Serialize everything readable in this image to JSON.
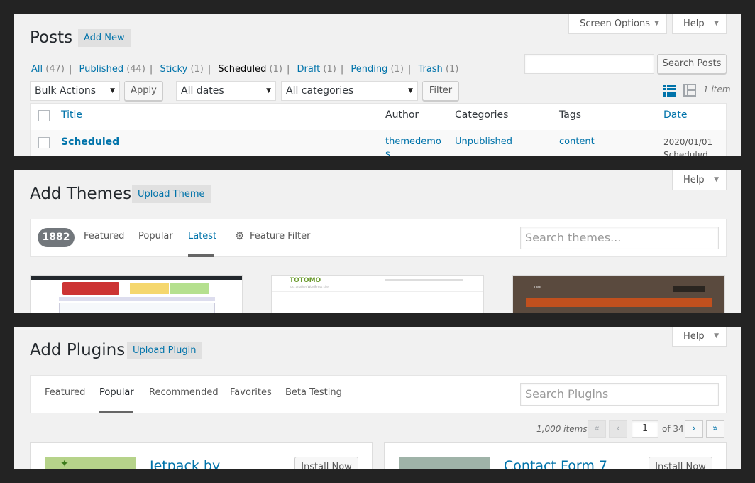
{
  "posts": {
    "title": "Posts",
    "add_new": "Add New",
    "screen_options": "Screen Options",
    "help": "Help",
    "views": [
      {
        "label": "All",
        "count": "(47)"
      },
      {
        "label": "Published",
        "count": "(44)"
      },
      {
        "label": "Sticky",
        "count": "(1)"
      },
      {
        "label": "Scheduled",
        "count": "(1)"
      },
      {
        "label": "Draft",
        "count": "(1)"
      },
      {
        "label": "Pending",
        "count": "(1)"
      },
      {
        "label": "Trash",
        "count": "(1)"
      }
    ],
    "search_button": "Search Posts",
    "search_value": "",
    "bulk_actions": "Bulk Actions",
    "apply": "Apply",
    "all_dates": "All dates",
    "all_categories": "All categories",
    "filter": "Filter",
    "item_count": "1 item",
    "columns": {
      "title": "Title",
      "author": "Author",
      "categories": "Categories",
      "tags": "Tags",
      "date": "Date"
    },
    "row": {
      "title": "Scheduled",
      "author_line1": "themedemo",
      "author_line2": "s",
      "category": "Unpublished",
      "tag": "content",
      "date": "2020/01/01",
      "status": "Scheduled"
    }
  },
  "themes": {
    "title": "Add Themes",
    "upload": "Upload Theme",
    "help": "Help",
    "count": "1882",
    "tabs": [
      "Featured",
      "Popular",
      "Latest"
    ],
    "feature_filter": "Feature Filter",
    "search_placeholder": "Search themes...",
    "thumb_totomo_name": "TOTOMO",
    "thumb_totomo_tagline": "just another WordPress site",
    "thumb_dark_name": "Dali"
  },
  "plugins": {
    "title": "Add Plugins",
    "upload": "Upload Plugin",
    "help": "Help",
    "tabs": [
      "Featured",
      "Popular",
      "Recommended",
      "Favorites",
      "Beta Testing"
    ],
    "search_placeholder": "Search Plugins",
    "items": "1,000 items",
    "page": "1",
    "of": "of 34",
    "first": "«",
    "prev": "‹",
    "next": "›",
    "last": "»",
    "cards": [
      {
        "title": "Jetpack by",
        "install": "Install Now"
      },
      {
        "title": "Contact Form 7",
        "install": "Install Now"
      }
    ]
  },
  "colors": {
    "link": "#0073aa",
    "panel": "#f1f1f1",
    "frame": "#232323",
    "orange": "#c1501e"
  }
}
